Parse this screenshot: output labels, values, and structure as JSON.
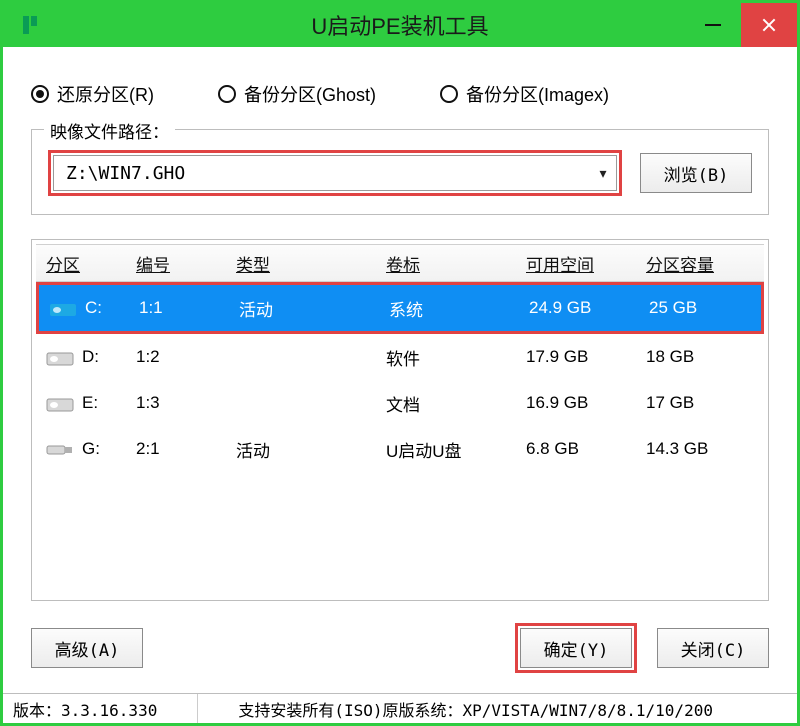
{
  "window": {
    "title": "U启动PE装机工具"
  },
  "radios": {
    "restore": {
      "label": "还原分区(R)",
      "selected": true
    },
    "backup": {
      "label": "备份分区(Ghost)",
      "selected": false
    },
    "imagex": {
      "label": "备份分区(Imagex)",
      "selected": false
    }
  },
  "image": {
    "group_label": "映像文件路径：",
    "path": "Z:\\WIN7.GHO",
    "browse": "浏览(B)"
  },
  "table": {
    "headers": {
      "part": "分区",
      "no": "编号",
      "type": "类型",
      "vol": "卷标",
      "free": "可用空间",
      "cap": "分区容量"
    },
    "rows": [
      {
        "drive": "C:",
        "no": "1:1",
        "type": "活动",
        "vol": "系统",
        "free": "24.9 GB",
        "cap": "25 GB",
        "selected": true,
        "icon": "hdd-blue"
      },
      {
        "drive": "D:",
        "no": "1:2",
        "type": "",
        "vol": "软件",
        "free": "17.9 GB",
        "cap": "18 GB",
        "selected": false,
        "icon": "hdd"
      },
      {
        "drive": "E:",
        "no": "1:3",
        "type": "",
        "vol": "文档",
        "free": "16.9 GB",
        "cap": "17 GB",
        "selected": false,
        "icon": "hdd"
      },
      {
        "drive": "G:",
        "no": "2:1",
        "type": "活动",
        "vol": "U启动U盘",
        "free": "6.8 GB",
        "cap": "14.3 GB",
        "selected": false,
        "icon": "usb"
      }
    ]
  },
  "buttons": {
    "advanced": "高级(A)",
    "ok": "确定(Y)",
    "close": "关闭(C)"
  },
  "status": {
    "version": "版本：3.3.16.330",
    "support": "支持安装所有(ISO)原版系统：XP/VISTA/WIN7/8/8.1/10/200"
  }
}
